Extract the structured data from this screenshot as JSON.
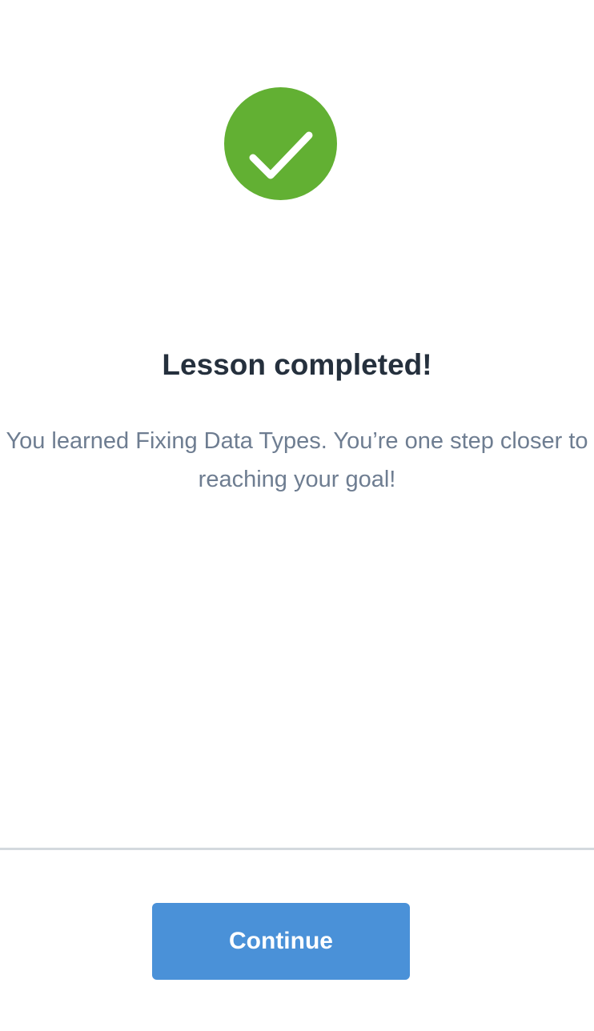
{
  "status_icon": {
    "name": "checkmark-icon",
    "color": "#62b033"
  },
  "lesson": {
    "title": "Lesson completed!",
    "message": "You learned Fixing Data Types. You’re one step closer to reaching your goal!"
  },
  "footer": {
    "continue_label": "Continue",
    "button_color": "#4a91d8"
  }
}
